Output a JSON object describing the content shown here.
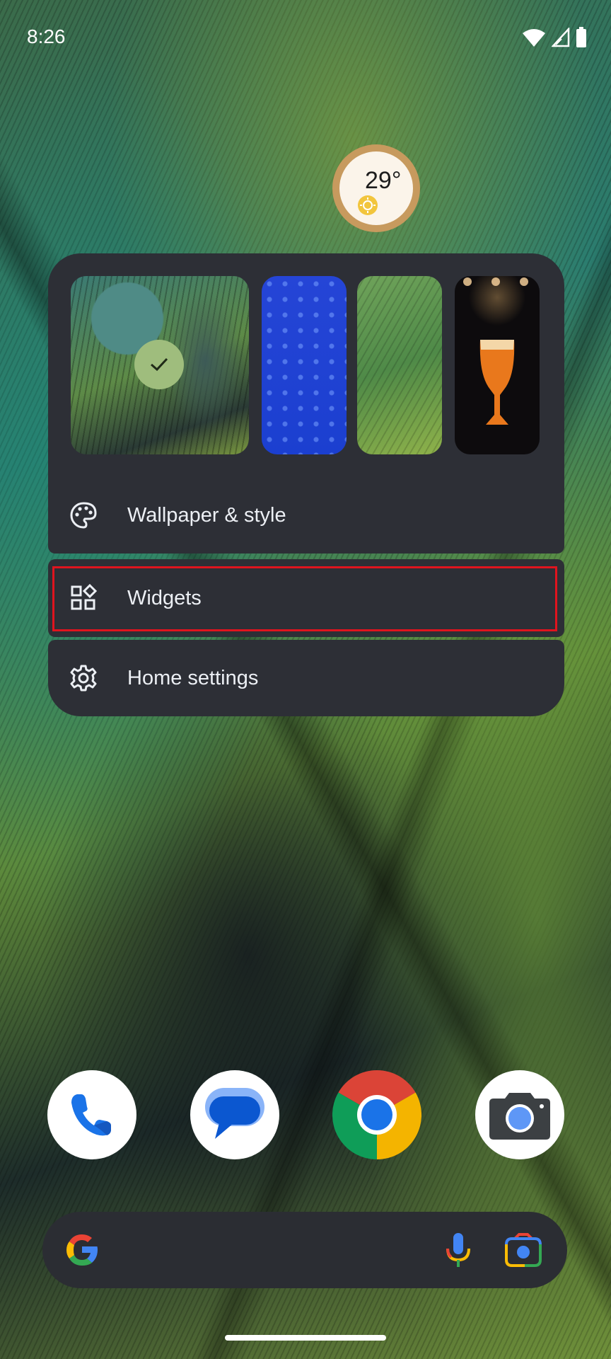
{
  "status_bar": {
    "time": "8:26"
  },
  "weather": {
    "temperature": "29°",
    "icon": "sunny-icon"
  },
  "menu": {
    "wallpapers": [
      {
        "name": "feathers-teal",
        "selected": true
      },
      {
        "name": "blue-emoji-pattern",
        "selected": false
      },
      {
        "name": "green-feathers",
        "selected": false
      },
      {
        "name": "beer-glass",
        "selected": false
      }
    ],
    "items": [
      {
        "label": "Wallpaper & style",
        "icon": "palette-icon"
      },
      {
        "label": "Widgets",
        "icon": "widgets-icon"
      },
      {
        "label": "Home settings",
        "icon": "gear-icon"
      }
    ]
  },
  "dock": [
    {
      "name": "Phone",
      "icon": "phone-icon"
    },
    {
      "name": "Messages",
      "icon": "messages-icon"
    },
    {
      "name": "Chrome",
      "icon": "chrome-icon"
    },
    {
      "name": "Camera",
      "icon": "camera-icon"
    }
  ],
  "search": {
    "icons": [
      "google-g-icon",
      "microphone-icon",
      "google-lens-icon"
    ]
  },
  "colors": {
    "menu_bg": "#2d2f36",
    "highlight": "#e0141e",
    "accent_check": "#9fbd7d"
  }
}
